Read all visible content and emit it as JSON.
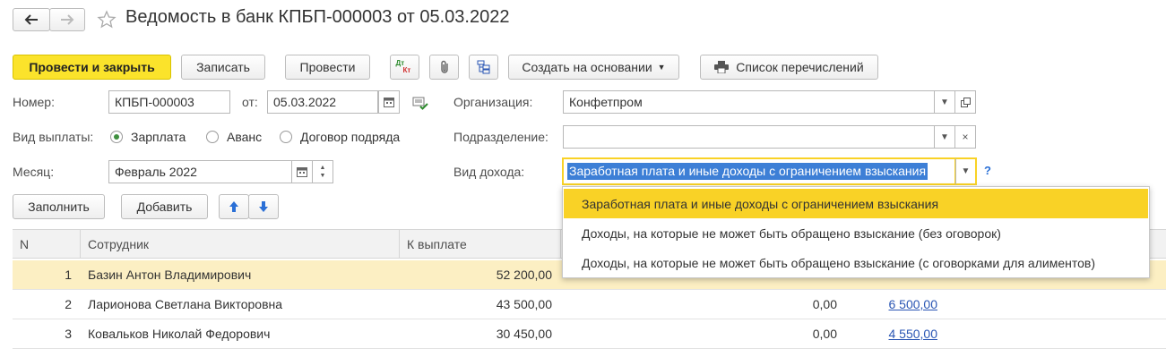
{
  "window": {
    "title": "Ведомость в банк КПБП-000003 от 05.03.2022"
  },
  "toolbar": {
    "post_close": "Провести и закрыть",
    "save": "Записать",
    "post": "Провести",
    "dt_kt_icon_top": "Дт",
    "dt_kt_icon_bottom": "Кт",
    "create_based": "Создать на основании",
    "transfer_list": "Список перечислений"
  },
  "form": {
    "number_label": "Номер:",
    "number_value": "КПБП-000003",
    "from_label": "от:",
    "date_value": "05.03.2022",
    "org_label": "Организация:",
    "org_value": "Конфетпром",
    "pay_type_label": "Вид выплаты:",
    "pay_types": [
      "Зарплата",
      "Аванс",
      "Договор подряда"
    ],
    "pay_type_selected": "Зарплата",
    "dept_label": "Подразделение:",
    "dept_value": "",
    "month_label": "Месяц:",
    "month_value": "Февраль 2022",
    "income_label": "Вид дохода:",
    "income_value": "Заработная плата и иные доходы с ограничением взыскания",
    "help_mark": "?"
  },
  "table_toolbar": {
    "fill": "Заполнить",
    "add": "Добавить"
  },
  "table": {
    "columns": [
      "N",
      "Сотрудник",
      "К выплате"
    ],
    "rows": [
      {
        "n": "1",
        "employee": "Базин Антон Владимирович",
        "amount": "52 200,00",
        "c4": "",
        "c5": "",
        "selected": true
      },
      {
        "n": "2",
        "employee": "Ларионова Светлана Викторовна",
        "amount": "43 500,00",
        "c4": "0,00",
        "c5": "6 500,00",
        "selected": false
      },
      {
        "n": "3",
        "employee": "Ковальков Николай Федорович",
        "amount": "30 450,00",
        "c4": "0,00",
        "c5": "4 550,00",
        "selected": false
      }
    ]
  },
  "dropdown": {
    "options": [
      "Заработная плата и иные доходы с ограничением взыскания",
      "Доходы, на которые не может быть обращено взыскание (без оговорок)",
      "Доходы, на которые не может быть обращено взыскание (с оговорками для алиментов)"
    ],
    "highlighted": "Заработная плата и иные доходы с ограничением взыскания"
  },
  "colors": {
    "accent": "#fbe32b",
    "selected_row": "#fcefc3",
    "highlight": "#f9d226",
    "link": "#2a56b4",
    "selection": "#3d7fd6"
  }
}
